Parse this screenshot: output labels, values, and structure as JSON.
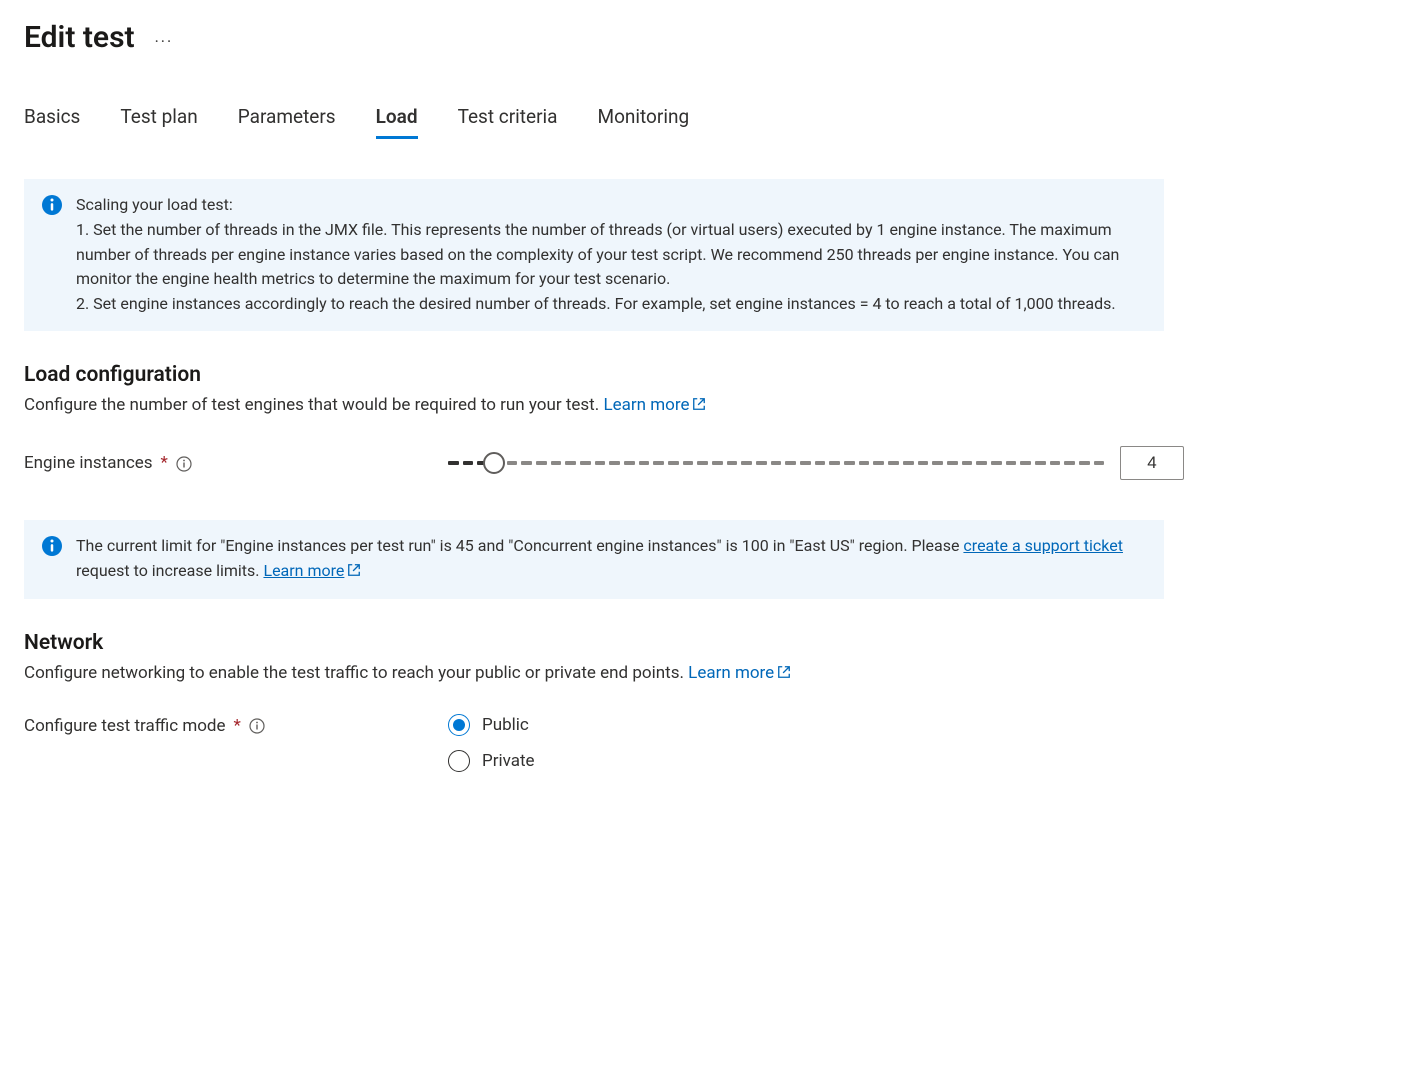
{
  "page": {
    "title": "Edit test"
  },
  "tabs": {
    "items": [
      {
        "label": "Basics",
        "active": false
      },
      {
        "label": "Test plan",
        "active": false
      },
      {
        "label": "Parameters",
        "active": false
      },
      {
        "label": "Load",
        "active": true
      },
      {
        "label": "Test criteria",
        "active": false
      },
      {
        "label": "Monitoring",
        "active": false
      }
    ]
  },
  "scaling_info": {
    "title": "Scaling your load test:",
    "line1": "1. Set the number of threads in the JMX file. This represents the number of threads (or virtual users) executed by 1 engine instance. The maximum number of threads per engine instance varies based on the complexity of your test script. We recommend 250 threads per engine instance. You can monitor the engine health metrics to determine the maximum for your test scenario.",
    "line2": "2. Set engine instances accordingly to reach the desired number of threads. For example, set engine instances = 4 to reach a total of 1,000 threads."
  },
  "load_config": {
    "heading": "Load configuration",
    "description": "Configure the number of test engines that would be required to run your test. ",
    "learn_more": "Learn more",
    "engine_label": "Engine instances",
    "engine_value": "4"
  },
  "limit_info": {
    "text_prefix": "The current limit for \"Engine instances per test run\" is 45 and \"Concurrent engine instances\" is 100 in \"East US\" region. Please ",
    "ticket_link": "create a support ticket",
    "text_mid": " request to increase limits. ",
    "learn_more": "Learn more"
  },
  "network": {
    "heading": "Network",
    "description": "Configure networking to enable the test traffic to reach your public or private end points. ",
    "learn_more": "Learn more",
    "mode_label": "Configure test traffic mode",
    "options": {
      "public": "Public",
      "private": "Private"
    },
    "selected": "public"
  }
}
